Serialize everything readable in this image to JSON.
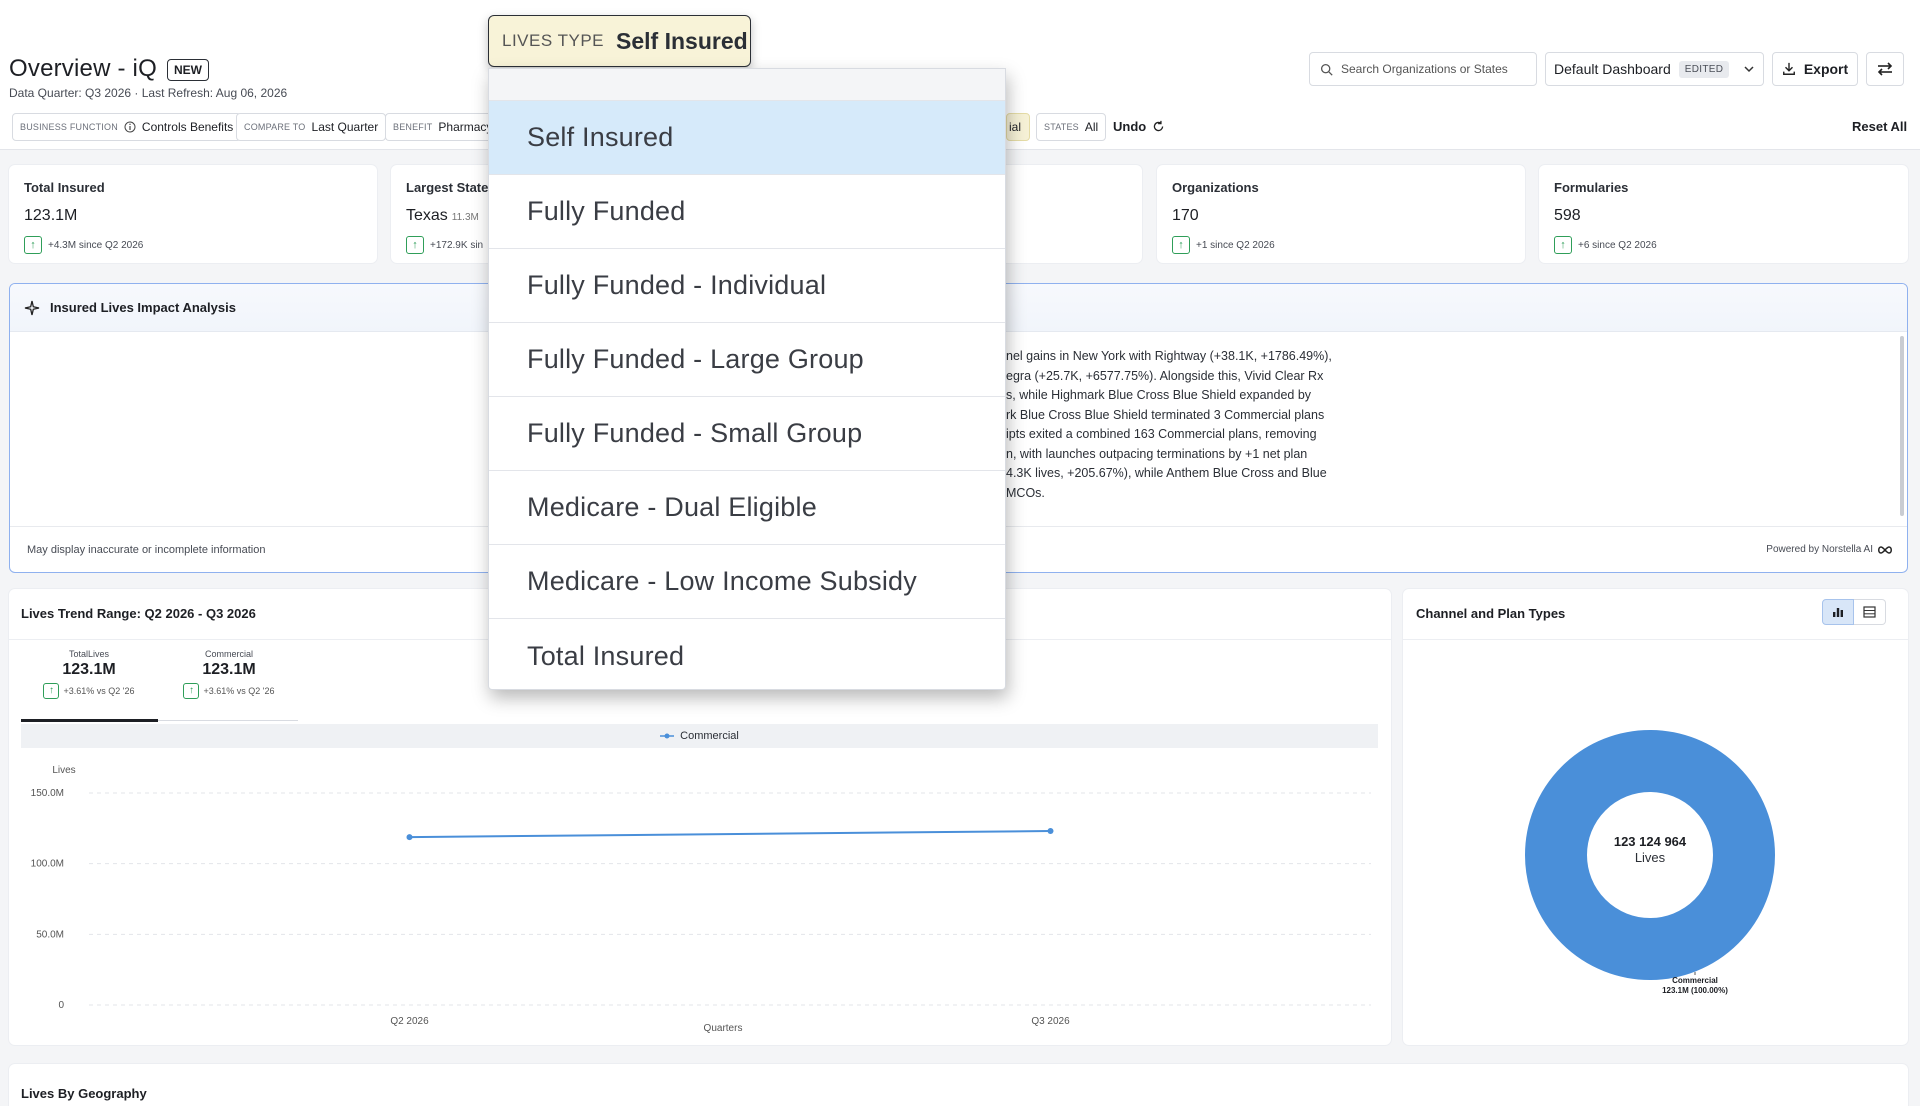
{
  "header": {
    "title": "Overview - iQ",
    "badge": "NEW",
    "subtitle": "Data Quarter: Q3 2026 · Last Refresh: Aug 06, 2026",
    "search_placeholder": "Search Organizations or States",
    "dashboard_select": "Default Dashboard",
    "dashboard_edited": "EDITED",
    "export_label": "Export"
  },
  "filters": {
    "business_function": {
      "key": "BUSINESS FUNCTION",
      "value": "Controls Benefits"
    },
    "compare_to": {
      "key": "COMPARE TO",
      "value": "Last Quarter"
    },
    "benefit": {
      "key": "BENEFIT",
      "value": "Pharmacy"
    },
    "lives_partial": "ial",
    "states": {
      "key": "STATES",
      "value": "All"
    },
    "undo_label": "Undo",
    "reset_label": "Reset All"
  },
  "kpis": [
    {
      "label": "Total Insured",
      "value": "123.1M",
      "sub": "",
      "delta": "+4.3M since Q2 2026"
    },
    {
      "label": "Largest State",
      "value": "Texas",
      "sub": "11.3M",
      "delta": "+172.9K sin"
    },
    {
      "label": "Organizations",
      "value": "170",
      "sub": "",
      "delta": "+1 since Q2 2026"
    },
    {
      "label": "Formularies",
      "value": "598",
      "sub": "",
      "delta": "+6 since Q2 2026"
    }
  ],
  "analysis": {
    "title": "Insured Lives Impact Analysis",
    "lines": [
      "nel gains in New York with Rightway (+38.1K, +1786.49%),",
      "egra (+25.7K, +6577.75%). Alongside this, Vivid Clear Rx",
      "s, while Highmark Blue Cross Blue Shield expanded by",
      "rk Blue Cross Blue Shield terminated 3 Commercial plans",
      "ipts exited a combined 163 Commercial plans, removing",
      "n, with launches outpacing terminations by +1 net plan",
      "4.3K lives, +205.67%), while Anthem Blue Cross and Blue",
      "MCOs."
    ],
    "disclaimer": "May display inaccurate or incomplete information",
    "powered_by": "Powered by Norstella AI"
  },
  "trend": {
    "title": "Lives Trend Range: Q2 2026 - Q3 2026",
    "tabs": [
      {
        "name": "TotalLives",
        "value": "123.1M",
        "delta": "+3.61% vs Q2 '26"
      },
      {
        "name": "Commercial",
        "value": "123.1M",
        "delta": "+3.61% vs Q2 '26"
      }
    ],
    "legend": "Commercial"
  },
  "chart_data": {
    "type": "line",
    "x": [
      "Q2 2026",
      "Q3 2026"
    ],
    "series": [
      {
        "name": "Commercial",
        "values": [
          118.8,
          123.1
        ]
      }
    ],
    "ylabel": "Lives",
    "xlabel": "Quarters",
    "ylim": [
      0,
      150
    ],
    "yticks": [
      "0",
      "50.0M",
      "100.0M",
      "150.0M"
    ],
    "grid": true,
    "line_color": "#4a8fd9"
  },
  "channel": {
    "title": "Channel and Plan Types",
    "center_value": "123 124 964",
    "center_label": "Lives",
    "slice_label": "Commercial",
    "slice_value": "123.1M (100.00%)",
    "slice_percent": 100,
    "donut_color": "#4a8fd9"
  },
  "geography": {
    "title": "Lives By Geography"
  },
  "dropdown": {
    "key": "LIVES TYPE",
    "selected": "Self Insured",
    "options": [
      "Self Insured",
      "Fully Funded",
      "Fully Funded - Individual",
      "Fully Funded - Large Group",
      "Fully Funded - Small Group",
      "Medicare - Dual Eligible",
      "Medicare - Low Income Subsidy",
      "Total Insured"
    ]
  }
}
